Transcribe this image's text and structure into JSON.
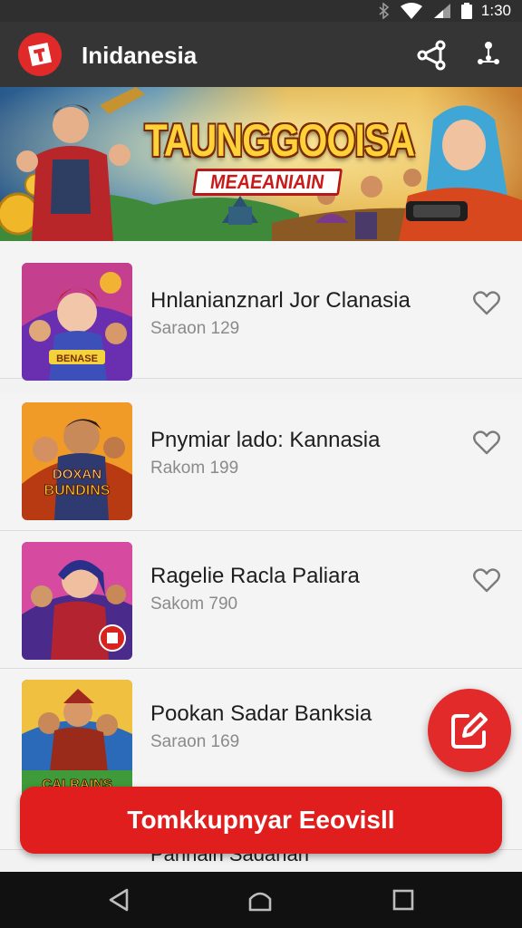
{
  "status_bar": {
    "time": "1:30"
  },
  "app_bar": {
    "title": "Inidanesia"
  },
  "banner": {
    "title": "TAUNGGOOISA",
    "subtitle": "MEAEANIAIN"
  },
  "games": [
    {
      "title": "Hnlanianznarl Jor Clanasia",
      "subtitle": "Saraon 129",
      "thumb_caption": "BENASE"
    },
    {
      "title": "Pnymiar lado: Kannasia",
      "subtitle": "Rakom 199",
      "thumb_caption": "BUNDINS"
    },
    {
      "title": "Ragelie Racla Paliara",
      "subtitle": "Sakom 790",
      "thumb_caption": ""
    },
    {
      "title": "Pookan Sadar Banksia",
      "subtitle": "Saraon 169",
      "thumb_caption": "CALRAINS"
    }
  ],
  "cut_item": {
    "title": "Panhain Sadahan"
  },
  "cta_label": "Tomkkupnyar Eeovisll",
  "colors": {
    "accent": "#e01e1e",
    "app_bar": "#353535",
    "nav_bar": "#111111"
  }
}
